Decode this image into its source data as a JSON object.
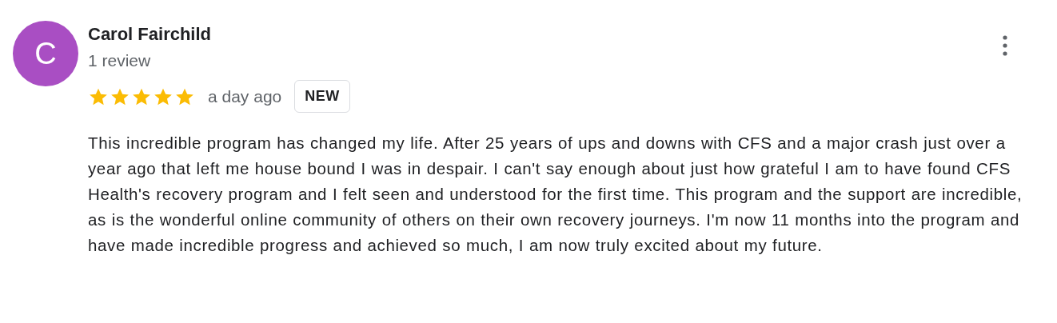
{
  "review": {
    "avatar_letter": "C",
    "author": "Carol Fairchild",
    "author_meta": "1 review",
    "stars": 5,
    "time": "a day ago",
    "badge": "NEW",
    "text": "This incredible program has changed my life. After 25 years of ups and downs with CFS and a major crash just over a year ago that left me house bound I was in despair. I can't say enough about just how grateful I am to have found CFS Health's recovery program and I felt seen and understood for the first time. This program and the support are incredible, as is the wonderful online community of others on their own recovery journeys. I'm now 11 months into the program and have made incredible progress and achieved so much, I am now truly excited about my future."
  }
}
